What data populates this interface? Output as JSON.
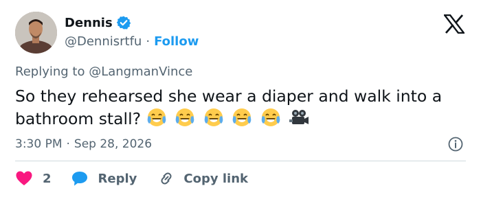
{
  "author": {
    "display_name": "Dennis",
    "handle": "@Dennisrtfu",
    "separator": "·",
    "follow_label": "Follow",
    "verified": true
  },
  "reply_context": {
    "prefix": "Replying to",
    "mention": "@LangmanVince"
  },
  "tweet": {
    "text": "So they rehearsed she wear a diaper and walk into a bathroom stall?",
    "emojis": [
      "face-with-tears-of-joy",
      "face-with-tears-of-joy",
      "face-with-tears-of-joy",
      "face-with-tears-of-joy",
      "face-with-tears-of-joy",
      "movie-camera"
    ]
  },
  "meta": {
    "time": "3:30 PM",
    "separator": "·",
    "date": "Sep 28, 2026"
  },
  "actions": {
    "like_count": "2",
    "reply_label": "Reply",
    "copy_link_label": "Copy link"
  },
  "icons": {
    "verified": "verified-badge-icon",
    "logo": "x-logo-icon",
    "info": "info-icon",
    "like": "heart-icon",
    "reply": "reply-bubble-icon",
    "copy": "link-icon"
  },
  "colors": {
    "accent": "#1d9bf0",
    "like": "#f91880",
    "muted": "#536471",
    "text": "#0f1419",
    "divider": "#cfd9de"
  }
}
